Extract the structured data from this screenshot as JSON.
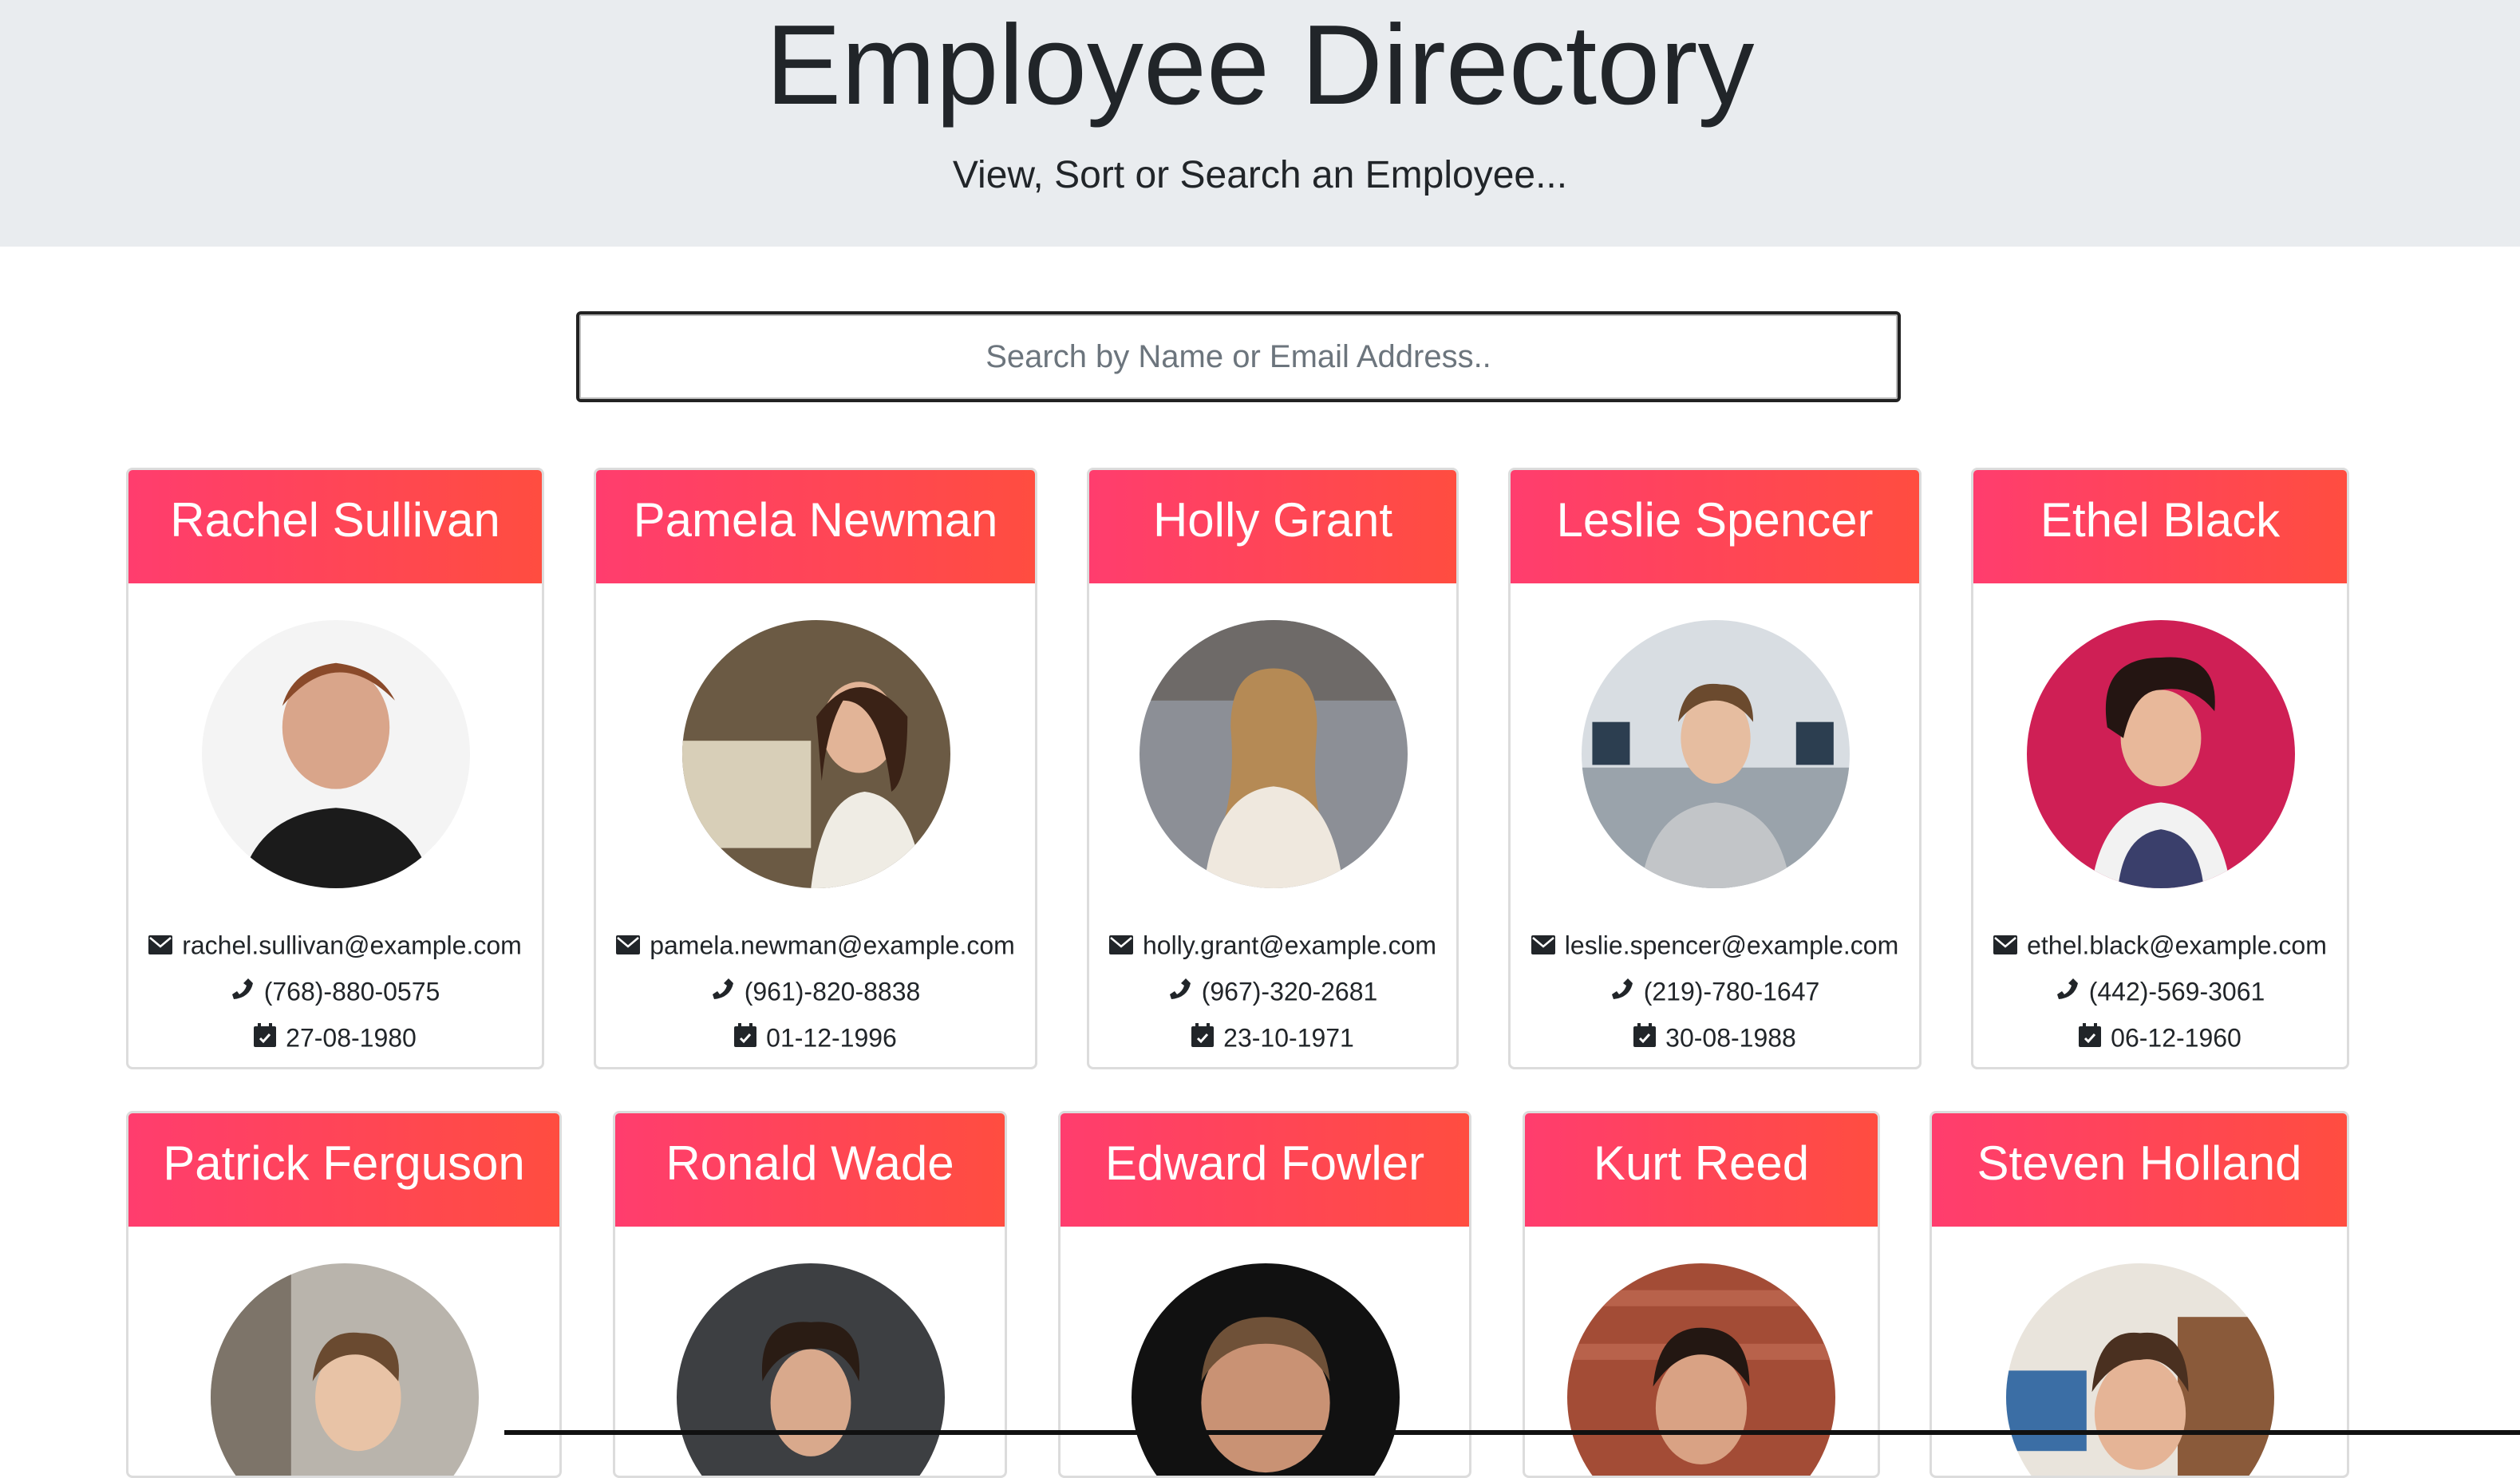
{
  "header": {
    "title": "Employee Directory",
    "subtitle": "View, Sort or Search an Employee..."
  },
  "search": {
    "placeholder": "Search by Name or Email Address..",
    "value": ""
  },
  "colors": {
    "card_gradient_start": "#ff3d6e",
    "card_gradient_end": "#ff4d40",
    "header_bg": "#e9ecef"
  },
  "icons": {
    "email": "envelope-icon",
    "phone": "phone-icon",
    "dob": "calendar-icon"
  },
  "employees": [
    {
      "name": "Rachel Sullivan",
      "email": "rachel.sullivan@example.com",
      "phone": "(768)-880-0575",
      "dob": "27-08-1980"
    },
    {
      "name": "Pamela Newman",
      "email": "pamela.newman@example.com",
      "phone": "(961)-820-8838",
      "dob": "01-12-1996"
    },
    {
      "name": "Holly Grant",
      "email": "holly.grant@example.com",
      "phone": "(967)-320-2681",
      "dob": "23-10-1971"
    },
    {
      "name": "Leslie Spencer",
      "email": "leslie.spencer@example.com",
      "phone": "(219)-780-1647",
      "dob": "30-08-1988"
    },
    {
      "name": "Ethel Black",
      "email": "ethel.black@example.com",
      "phone": "(442)-569-3061",
      "dob": "06-12-1960"
    },
    {
      "name": "Patrick Ferguson"
    },
    {
      "name": "Ronald Wade"
    },
    {
      "name": "Edward Fowler"
    },
    {
      "name": "Kurt Reed"
    },
    {
      "name": "Steven Holland"
    }
  ]
}
